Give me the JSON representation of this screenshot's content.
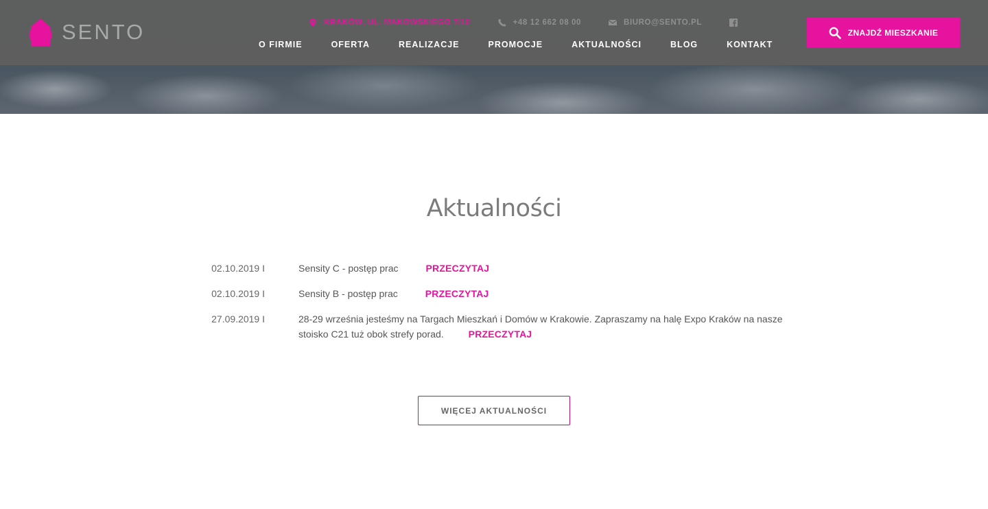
{
  "brand": {
    "name": "SENTO",
    "accent": "#e5139d"
  },
  "header": {
    "address": "KRAKÓW, UL. MAKOWSKIEGO 7/10",
    "phone": "+48 12 662 08 00",
    "email": "BIURO@SENTO.PL",
    "nav": [
      {
        "label": "O FIRMIE"
      },
      {
        "label": "OFERTA"
      },
      {
        "label": "REALIZACJE"
      },
      {
        "label": "PROMOCJE"
      },
      {
        "label": "AKTUALNOŚCI"
      },
      {
        "label": "BLOG"
      },
      {
        "label": "KONTAKT"
      }
    ],
    "cta_label": "ZNAJDŹ MIESZKANIE"
  },
  "news": {
    "title": "Aktualności",
    "read_label": "PRZECZYTAJ",
    "items": [
      {
        "date": "02.10.2019 I",
        "text": "Sensity C - postęp prac"
      },
      {
        "date": "02.10.2019 I",
        "text": "Sensity B - postęp prac"
      },
      {
        "date": "27.09.2019 I",
        "text": "28-29 września jesteśmy na Targach Mieszkań i Domów w Krakowie. Zapraszamy na halę Expo Kraków na nasze stoisko C21 tuż obok strefy porad."
      }
    ],
    "more_label": "WIĘCEJ AKTUALNOŚCI"
  }
}
